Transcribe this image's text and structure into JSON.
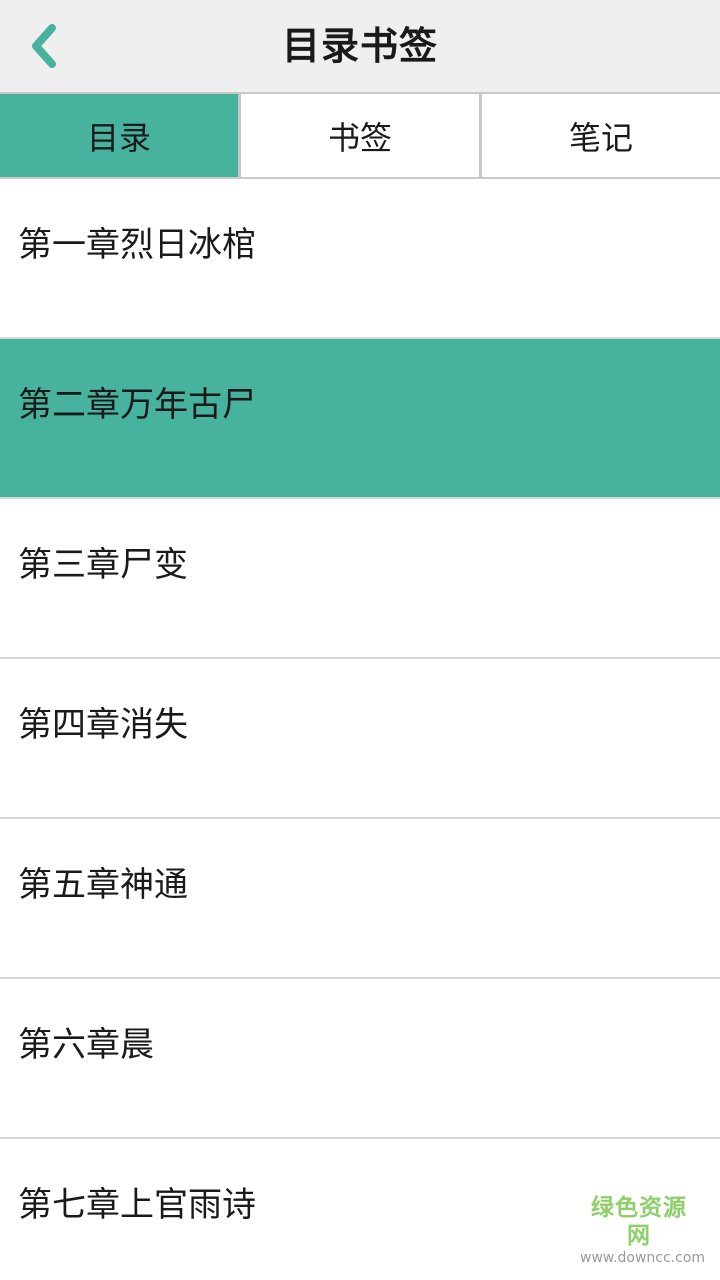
{
  "header": {
    "title": "目录书签",
    "back_icon": "chevron-left-icon",
    "accent_color": "#47b39f"
  },
  "tabs": [
    {
      "label": "目录",
      "active": true
    },
    {
      "label": "书签",
      "active": false
    },
    {
      "label": "笔记",
      "active": false
    }
  ],
  "chapters": [
    {
      "label": "第一章烈日冰棺",
      "selected": false
    },
    {
      "label": "第二章万年古尸",
      "selected": true
    },
    {
      "label": "第三章尸变",
      "selected": false
    },
    {
      "label": "第四章消失",
      "selected": false
    },
    {
      "label": "第五章神通",
      "selected": false
    },
    {
      "label": "第六章晨",
      "selected": false
    },
    {
      "label": "第七章上官雨诗",
      "selected": false
    }
  ],
  "watermark": {
    "main": "绿色资源网",
    "sub": "www.downcc.com"
  },
  "colors": {
    "header_bg": "#efefef",
    "selected_bg": "#47b39f",
    "divider": "#d6d6d6"
  }
}
